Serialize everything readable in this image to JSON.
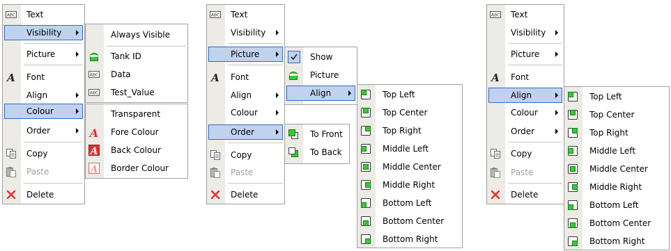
{
  "labels": {
    "text": "Text",
    "visibility": "Visibility",
    "picture": "Picture",
    "font": "Font",
    "align": "Align",
    "colour": "Colour",
    "order": "Order",
    "copy": "Copy",
    "paste": "Paste",
    "delete": "Delete"
  },
  "visibility_submenu": {
    "always_visible": "Always Visible",
    "tank_id": "Tank ID",
    "data": "Data",
    "test_value": "Test_Value"
  },
  "colour_submenu": {
    "transparent": "Transparent",
    "fore_colour": "Fore Colour",
    "back_colour": "Back Colour",
    "border_colour": "Border Colour"
  },
  "picture_submenu": {
    "show": "Show",
    "picture": "Picture",
    "align": "Align"
  },
  "order_submenu": {
    "to_front": "To Front",
    "to_back": "To Back"
  },
  "align_positions": {
    "top_left": "Top Left",
    "top_center": "Top Center",
    "top_right": "Top Right",
    "middle_left": "Middle Left",
    "middle_center": "Middle Center",
    "middle_right": "Middle Right",
    "bottom_left": "Bottom Left",
    "bottom_center": "Bottom Center",
    "bottom_right": "Bottom Right"
  },
  "colors": {
    "highlight_fill": "#c1d2ee",
    "highlight_border": "#316ac5",
    "gutter": "#ecebe6",
    "icon_green": "#33cc33",
    "delete_red": "#e03030",
    "disabled_text": "#a0a0a0"
  },
  "icons": {
    "text": "abc-icon",
    "font": "font-a-icon",
    "copy": "copy-icon",
    "paste": "paste-icon",
    "delete": "delete-x-icon",
    "picture": "tank-icon",
    "show": "checkmark-icon",
    "fore_colour": "fore-colour-icon",
    "back_colour": "back-colour-icon",
    "border_colour": "border-colour-icon",
    "to_front": "bring-to-front-icon",
    "to_back": "send-to-back-icon",
    "alignment": "alignment-position-icon"
  },
  "state": {
    "panel_1": {
      "highlighted": [
        "visibility",
        "colour"
      ],
      "open_submenus": [
        "visibility",
        "colour"
      ],
      "disabled": [
        "paste"
      ]
    },
    "panel_2": {
      "highlighted": [
        "picture",
        "order",
        "picture_submenu.align"
      ],
      "open_submenus": [
        "picture",
        "order",
        "picture_submenu.align"
      ],
      "checked": [
        "picture_submenu.show"
      ],
      "disabled": [
        "paste"
      ]
    },
    "panel_3": {
      "highlighted": [
        "align"
      ],
      "open_submenus": [
        "align"
      ],
      "disabled": [
        "paste"
      ]
    }
  }
}
